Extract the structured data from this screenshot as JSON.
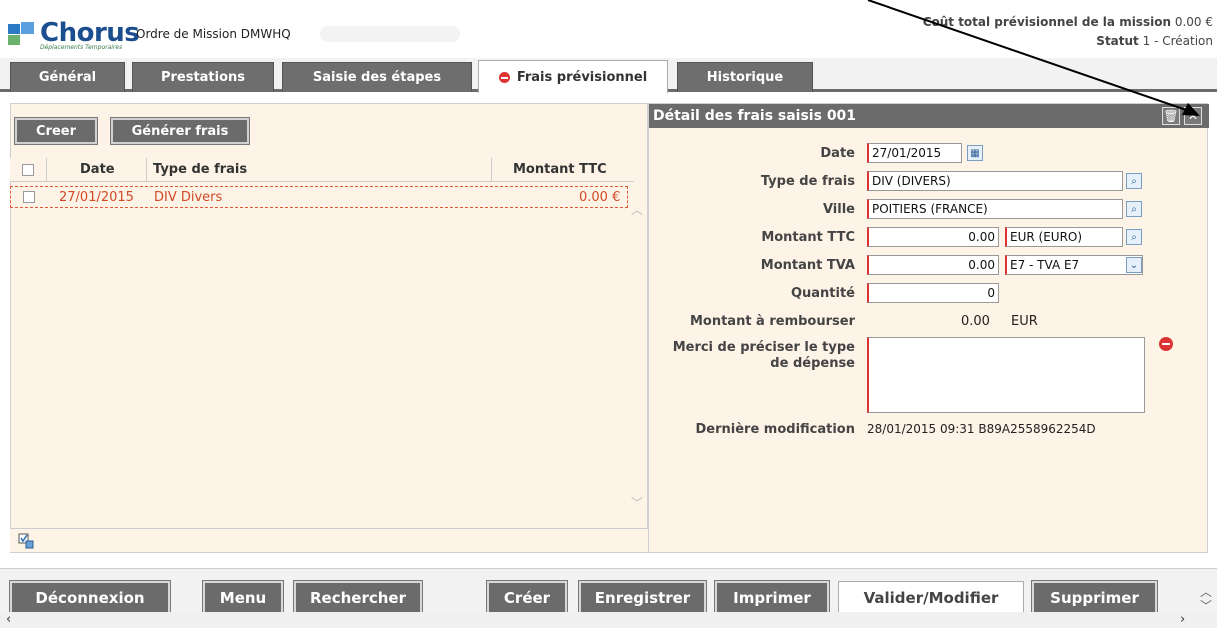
{
  "header": {
    "logo_text": "Chorus",
    "logo_subtitle": "Déplacements Temporaires",
    "mission_title": "Ordre de Mission DMWHQ",
    "cost_label": "Coût total prévisionnel de la mission",
    "cost_value": "0.00 €",
    "status_label": "Statut",
    "status_value": "1 - Création"
  },
  "tabs": [
    {
      "label": "Général"
    },
    {
      "label": "Prestations"
    },
    {
      "label": "Saisie des étapes"
    },
    {
      "label": "Frais prévisionnel"
    },
    {
      "label": "Historique"
    }
  ],
  "left": {
    "create_label": "Creer",
    "generate_label": "Générer frais",
    "columns": {
      "date": "Date",
      "type": "Type de frais",
      "amount": "Montant TTC"
    },
    "rows": [
      {
        "date": "27/01/2015",
        "type": "DIV Divers",
        "amount": "0.00 €"
      }
    ]
  },
  "detail": {
    "title": "Détail des frais saisis 001",
    "date_label": "Date",
    "date_value": "27/01/2015",
    "type_label": "Type de frais",
    "type_value": "DIV (DIVERS)",
    "city_label": "Ville",
    "city_value": "POITIERS (FRANCE)",
    "ttc_label": "Montant TTC",
    "ttc_value": "0.00",
    "currency_value": "EUR (EURO)",
    "tva_label": "Montant TVA",
    "tva_value": "0.00",
    "tva_code": "E7 - TVA E7",
    "qty_label": "Quantité",
    "qty_value": "0",
    "refund_label": "Montant à rembourser",
    "refund_value": "0.00",
    "refund_currency": "EUR",
    "note_label_1": "Merci de préciser le type",
    "note_label_2": "de dépense",
    "note_value": "",
    "lastmod_label": "Dernière modification",
    "lastmod_value": "28/01/2015 09:31 B89A2558962254D"
  },
  "bottom": {
    "logout": "Déconnexion",
    "menu": "Menu",
    "search": "Rechercher",
    "create": "Créer",
    "save": "Enregistrer",
    "print": "Imprimer",
    "validate": "Valider/Modifier",
    "delete": "Supprimer"
  },
  "colors": {
    "tab_bg": "#6e6e6e",
    "pane_bg": "#fdf3e6",
    "required": "#dd3333",
    "brand": "#1b4e8f"
  }
}
